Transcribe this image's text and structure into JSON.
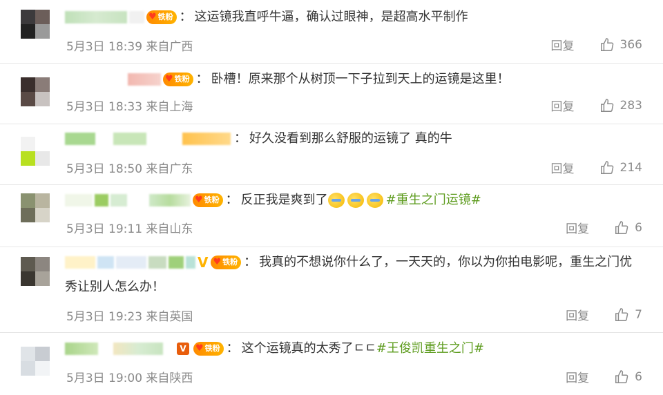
{
  "labels": {
    "reply": "回复",
    "fan_badge": "铁粉",
    "separator": "："
  },
  "comments": [
    {
      "text": "这运镜我直呼牛逼，确认过眼神，是超高水平制作",
      "time": "5月3日 18:39 来自广西",
      "likes": "366"
    },
    {
      "text": "卧槽！原来那个从树顶一下子拉到天上的运镜是这里！",
      "time": "5月3日 18:33 来自上海",
      "likes": "283"
    },
    {
      "text": "好久没看到那么舒服的运镜了 真的牛",
      "time": "5月3日 18:50 来自广东",
      "likes": "214"
    },
    {
      "text": "反正我是爽到了",
      "topic": "#重生之门运镜#",
      "time": "5月3日 19:11 来自山东",
      "likes": "6"
    },
    {
      "text": "我真的不想说你什么了，一天天的，你以为你拍电影呢，重生之门优",
      "text2": "秀让别人怎么办！",
      "time": "5月3日 19:23 来自英国",
      "likes": "7"
    },
    {
      "text": "这个运镜真的太秀了",
      "tail": "ㄷㄷ",
      "topic": "#王俊凯重生之门#",
      "time": "5月3日 19:00 来自陕西",
      "likes": "6"
    }
  ],
  "colors": {
    "topic": "#5e9c1f",
    "meta": "#8a8a8a",
    "badge": "#ff9d00"
  },
  "icons": {
    "like": "thumbs-up-icon",
    "badge": "fan-heart-icon",
    "vip": "vip-v-icon",
    "emoji": "grin-emoji-icon"
  }
}
